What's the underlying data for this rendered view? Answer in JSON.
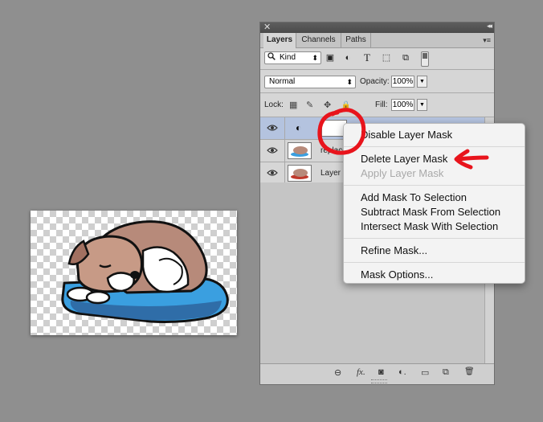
{
  "panel": {
    "tabs": [
      "Layers",
      "Channels",
      "Paths"
    ],
    "close_glyph": "✕",
    "collapse_glyph": "◂◂",
    "menu_glyph": "▾≡",
    "filter": {
      "label": "Kind",
      "icon": "search-icon",
      "arrow": "⬍"
    },
    "filter_icons": [
      {
        "name": "image-filter-icon",
        "glyph": "▣"
      },
      {
        "name": "adjustment-filter-icon",
        "glyph": "◐"
      },
      {
        "name": "type-filter-icon",
        "glyph": "T"
      },
      {
        "name": "shape-filter-icon",
        "glyph": "⬚"
      },
      {
        "name": "smart-object-filter-icon",
        "glyph": "⧉"
      }
    ],
    "blend_mode": "Normal",
    "blend_arrow": "⬍",
    "opacity_label": "Opacity:",
    "opacity_value": "100%",
    "lock_label": "Lock:",
    "fill_label": "Fill:",
    "fill_value": "100%",
    "dropdown_glyph": "▼",
    "lock_icons": [
      {
        "name": "lock-transparent-icon",
        "glyph": "▦"
      },
      {
        "name": "lock-pixels-icon",
        "glyph": "✎"
      },
      {
        "name": "lock-position-icon",
        "glyph": "✥"
      },
      {
        "name": "lock-all-icon",
        "glyph": "🔒"
      }
    ],
    "layers": [
      {
        "name": "",
        "selected": true,
        "adjustment_glyph": "◐"
      },
      {
        "name": "replace",
        "selected": false
      },
      {
        "name": "Layer 0",
        "selected": false
      }
    ],
    "eye_glyph": "👁",
    "bottom_icons": [
      {
        "name": "link-layers-icon",
        "glyph": "⊖"
      },
      {
        "name": "layer-style-icon",
        "glyph": "fx."
      },
      {
        "name": "add-mask-icon",
        "glyph": "◙"
      },
      {
        "name": "new-adjustment-layer-icon",
        "glyph": "◐."
      },
      {
        "name": "new-group-icon",
        "glyph": "▭"
      },
      {
        "name": "new-layer-icon",
        "glyph": "⧉"
      },
      {
        "name": "delete-layer-icon",
        "glyph": "🗑"
      }
    ]
  },
  "context_menu": {
    "groups": [
      [
        {
          "label": "Disable Layer Mask",
          "disabled": false
        }
      ],
      [
        {
          "label": "Delete Layer Mask",
          "disabled": false
        },
        {
          "label": "Apply Layer Mask",
          "disabled": true
        }
      ],
      [
        {
          "label": "Add Mask To Selection",
          "disabled": false
        },
        {
          "label": "Subtract Mask From Selection",
          "disabled": false
        },
        {
          "label": "Intersect Mask With Selection",
          "disabled": false
        }
      ],
      [
        {
          "label": "Refine Mask...",
          "disabled": false
        }
      ],
      [
        {
          "label": "Mask Options...",
          "disabled": false
        }
      ]
    ]
  },
  "annotation_color": "#e8141c"
}
